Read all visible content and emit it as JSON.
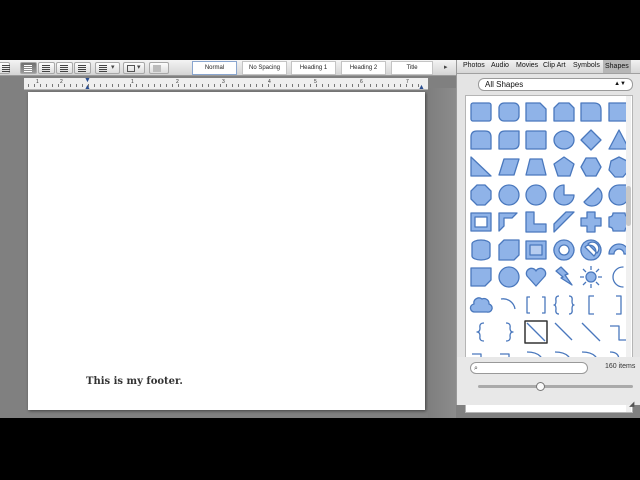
{
  "toolbar": {
    "styles": [
      "Normal",
      "No Spacing",
      "Heading 1",
      "Heading 2",
      "Title"
    ],
    "selected_style": "Normal"
  },
  "ruler": {
    "numbers": [
      "1",
      "2",
      "1",
      "2",
      "3",
      "4",
      "5",
      "6",
      "7"
    ]
  },
  "document": {
    "footer_text": "This is my footer."
  },
  "browser": {
    "tabs": [
      "Photos",
      "Audio",
      "Movies",
      "Clip Art",
      "Symbols",
      "Shapes"
    ],
    "active_tab": "Shapes",
    "category": "All Shapes",
    "search_placeholder": "",
    "item_count": "160 items",
    "zoom_level": 0.4,
    "shape_fill": "#8fb3e8",
    "shape_stroke": "#4a78bd",
    "shapes": [
      "rectangle",
      "rounded-rectangle",
      "snip-corner-rectangle",
      "snip-two-corner-rectangle",
      "round-corner-rectangle",
      "folded-rectangle",
      "round-same-side-rectangle",
      "round-diagonal-rectangle",
      "rectangle-alt",
      "oval",
      "diamond",
      "triangle",
      "right-triangle",
      "parallelogram",
      "trapezoid",
      "pentagon",
      "hexagon",
      "heptagon",
      "octagon",
      "decagon",
      "dodecagon",
      "pie",
      "chord",
      "teardrop",
      "frame",
      "half-frame",
      "l-shape",
      "diagonal-stripe",
      "cross",
      "plaque",
      "can",
      "cube",
      "bevel",
      "donut",
      "no-symbol",
      "block-arc",
      "folded-corner",
      "smiley-face",
      "heart",
      "lightning-bolt",
      "sun",
      "moon",
      "cloud",
      "arc",
      "double-bracket",
      "double-brace",
      "left-bracket",
      "right-bracket",
      "left-brace",
      "right-brace",
      "line",
      "line-arrow",
      "line-double-arrow",
      "elbow-connector",
      "elbow-arrow",
      "elbow-double-arrow",
      "curved-connector",
      "curved-arrow",
      "curved-double-arrow",
      "freeform"
    ]
  }
}
